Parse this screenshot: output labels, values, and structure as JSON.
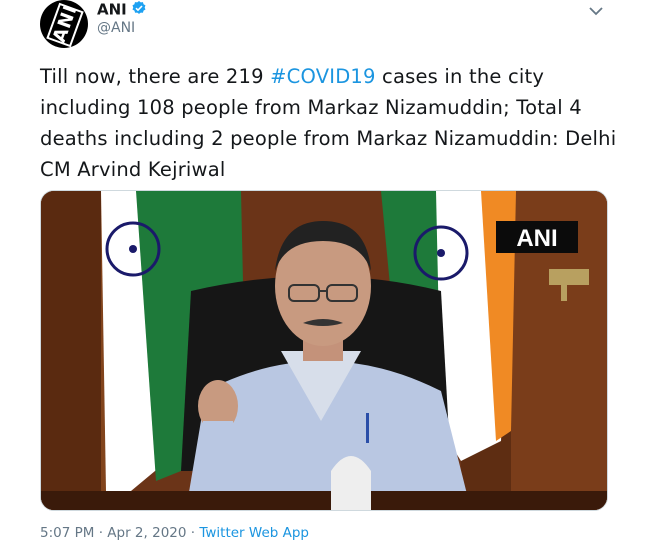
{
  "user": {
    "name": "ANI",
    "handle": "@ANI",
    "avatar_text": "ANI"
  },
  "tweet": {
    "text_before": "Till now, there are 219 ",
    "hashtag": "#COVID19",
    "text_after": " cases in the city including 108 people from Markaz Nizamuddin; Total 4 deaths including 2 people from Markaz Nizamuddin: Delhi CM Arvind Kejriwal"
  },
  "media": {
    "watermark": "ANI"
  },
  "meta": {
    "time": "5:07 PM",
    "separator1": " · ",
    "date": "Apr 2, 2020",
    "separator2": " · ",
    "source": "Twitter Web App"
  },
  "colors": {
    "accent": "#1b95e0",
    "secondary_text": "#657786",
    "verified": "#1da1f2"
  },
  "icons": [
    "verified-badge-icon",
    "chevron-down-icon"
  ]
}
